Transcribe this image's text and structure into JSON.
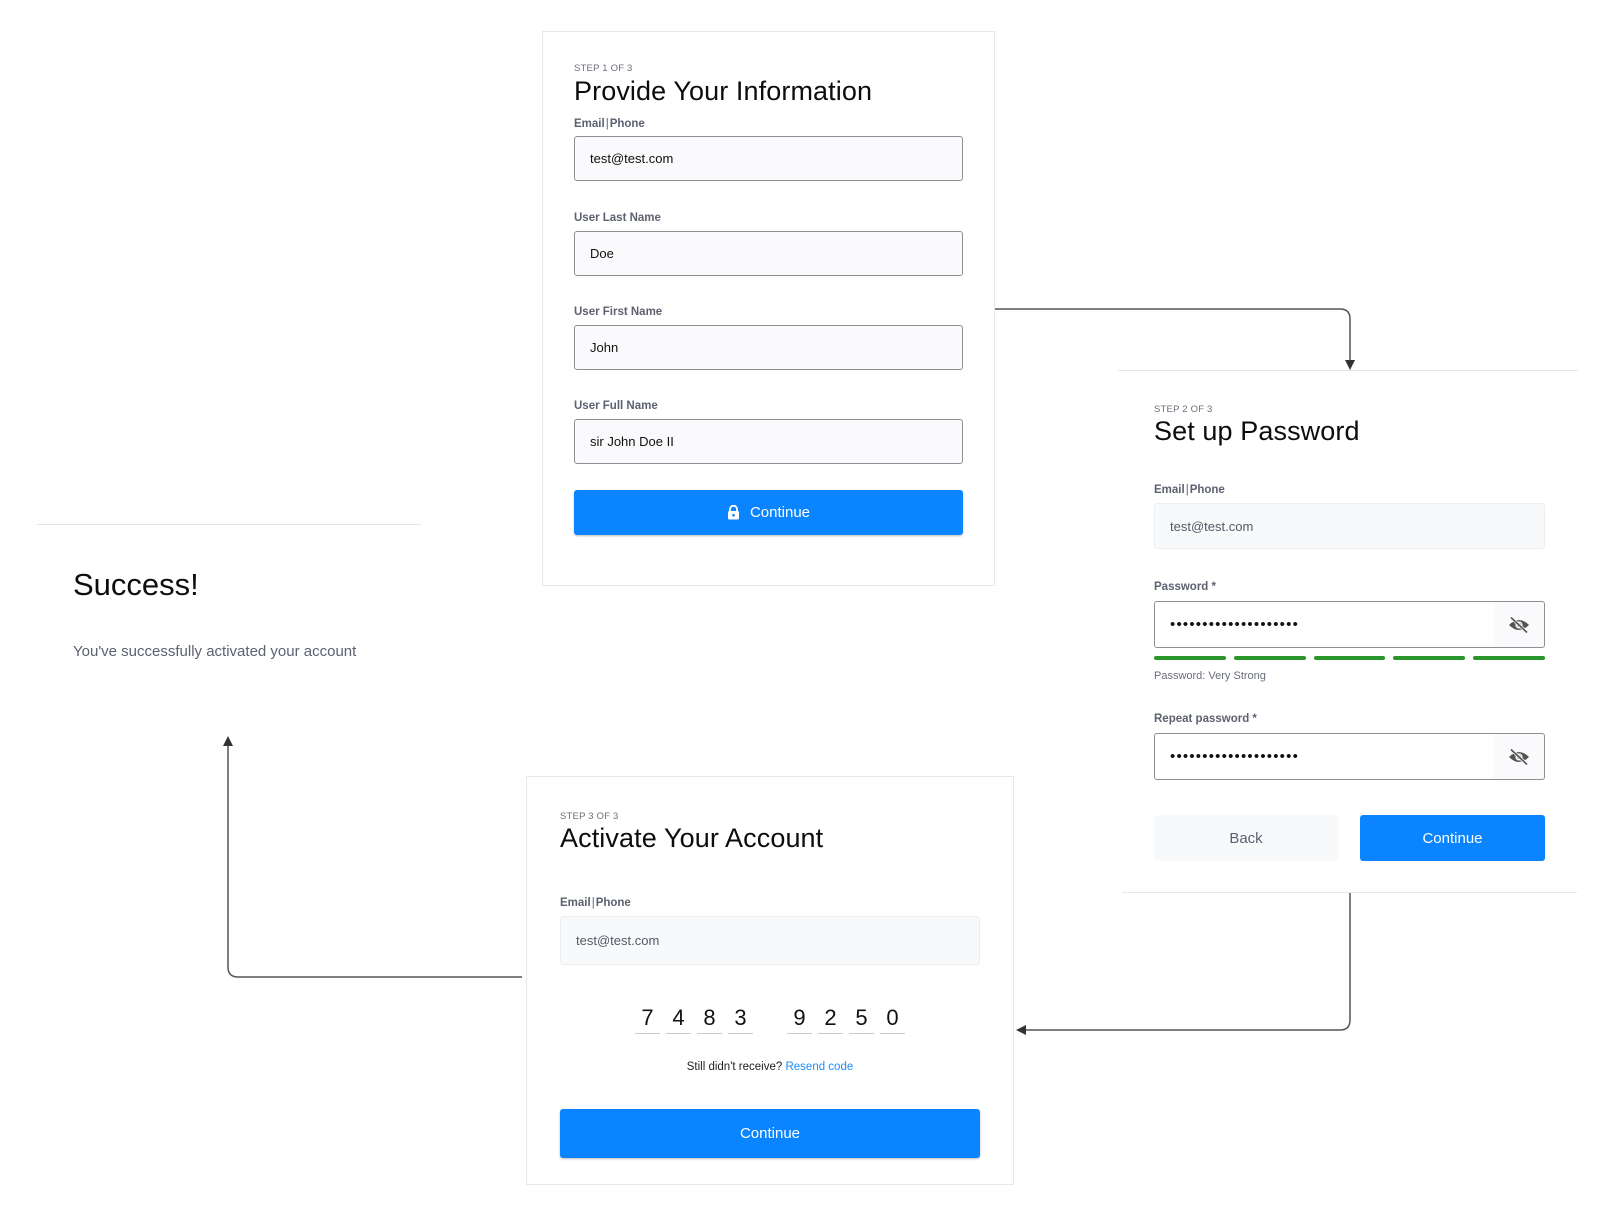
{
  "step1": {
    "step_label": "STEP 1 OF 3",
    "title": "Provide Your Information",
    "fields": [
      {
        "label_a": "Email",
        "label_sep": "|",
        "label_b": "Phone",
        "value": "test@test.com"
      },
      {
        "label": "User Last Name",
        "value": "Doe"
      },
      {
        "label": "User First Name",
        "value": "John"
      },
      {
        "label": "User Full Name",
        "value": "sir John Doe II"
      }
    ],
    "continue_label": "Continue",
    "continue_icon": "lock-icon"
  },
  "step2": {
    "step_label": "STEP 2 OF 3",
    "title": "Set up Password",
    "email_label_a": "Email",
    "email_label_sep": "|",
    "email_label_b": "Phone",
    "email_value": "test@test.com",
    "password_label": "Password *",
    "password_value": "••••••••••••••••••••",
    "password_toggle_icon": "eye-slash-icon",
    "strength_segments_total": 5,
    "strength_segments_filled": 5,
    "strength_color": "#2a962a",
    "strength_text": "Password: Very Strong",
    "repeat_label": "Repeat password *",
    "repeat_value": "••••••••••••••••••••",
    "back_label": "Back",
    "continue_label": "Continue"
  },
  "step3": {
    "step_label": "STEP 3 OF 3",
    "title": "Activate Your Account",
    "email_label_a": "Email",
    "email_label_sep": "|",
    "email_label_b": "Phone",
    "email_value": "test@test.com",
    "code_digits": [
      "7",
      "4",
      "8",
      "3",
      "9",
      "2",
      "5",
      "0"
    ],
    "resend_prompt": "Still didn't receive?",
    "resend_link": "Resend code",
    "continue_label": "Continue"
  },
  "success": {
    "title": "Success!",
    "message": "You've successfully activated your account"
  },
  "colors": {
    "primary": "#0a84ff",
    "link": "#1a8cff",
    "strength": "#2a962a"
  }
}
